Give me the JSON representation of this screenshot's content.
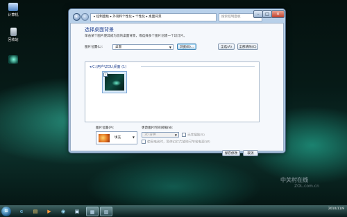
{
  "desktop": {
    "icons": [
      {
        "label": "计算机"
      },
      {
        "label": "回收站"
      },
      {
        "label": ""
      }
    ]
  },
  "window": {
    "address_bar": "▸ 控制面板 ▸ 外观和个性化 ▸ 个性化 ▸ 桌面背景",
    "search_placeholder": "搜索控制面板",
    "controls": {
      "minimize": "–",
      "maximize": "□",
      "close": "✕"
    },
    "heading": "选择桌面背景",
    "description": "单击某个图片使其成为您的桌面背景，或选择多个图片创建一个幻灯片。",
    "picture_location_label": "图片位置(L):",
    "picture_location_value": "桌面",
    "browse_button": "浏览(B)...",
    "select_all_button": "全选(A)",
    "clear_all_button": "全部清除(C)",
    "group_title": "C:\\用户\\ZOL\\桌面 (1)",
    "picture_position_label": "图片位置(P):",
    "picture_position_value": "填充",
    "change_interval_label": "更改图片时间间隔(N):",
    "change_interval_value": "30 分钟",
    "shuffle_label": "无序播放(S)",
    "battery_label": "使用电池时，暂停幻灯片放映可节省电源(W)",
    "save_button": "保存修改",
    "cancel_button": "取消"
  },
  "taskbar": {
    "clock_time": "",
    "clock_date": "2010/11/9"
  },
  "watermark": {
    "line1": "中关村在线",
    "line2": "ZOL.com.cn"
  }
}
